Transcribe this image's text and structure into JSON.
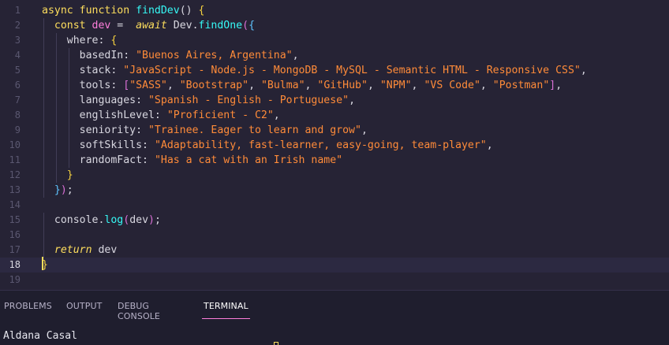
{
  "editor": {
    "current_line": 18,
    "lines": [
      {
        "n": "1",
        "tokens": [
          {
            "t": "async ",
            "c": "kw"
          },
          {
            "t": "function ",
            "c": "kw"
          },
          {
            "t": "findDev",
            "c": "fn"
          },
          {
            "t": "() ",
            "c": "obj"
          },
          {
            "t": "{",
            "c": "br1"
          }
        ]
      },
      {
        "n": "2",
        "tokens": [
          {
            "t": "  const ",
            "c": "kw"
          },
          {
            "t": "dev",
            "c": "var"
          },
          {
            "t": " =  ",
            "c": "obj"
          },
          {
            "t": "await ",
            "c": "kw2"
          },
          {
            "t": "Dev",
            "c": "obj"
          },
          {
            "t": ".",
            "c": "obj"
          },
          {
            "t": "findOne",
            "c": "fn"
          },
          {
            "t": "(",
            "c": "br2"
          },
          {
            "t": "{",
            "c": "br3"
          }
        ]
      },
      {
        "n": "3",
        "tokens": [
          {
            "t": "    where",
            "c": "prop"
          },
          {
            "t": ": ",
            "c": "obj"
          },
          {
            "t": "{",
            "c": "br1"
          }
        ]
      },
      {
        "n": "4",
        "tokens": [
          {
            "t": "      basedIn",
            "c": "prop"
          },
          {
            "t": ": ",
            "c": "obj"
          },
          {
            "t": "\"Buenos Aires, Argentina\"",
            "c": "str"
          },
          {
            "t": ",",
            "c": "obj"
          }
        ]
      },
      {
        "n": "5",
        "tokens": [
          {
            "t": "      stack",
            "c": "prop"
          },
          {
            "t": ": ",
            "c": "obj"
          },
          {
            "t": "\"JavaScript - Node.js - MongoDB - MySQL - Semantic HTML - Responsive CSS\"",
            "c": "str"
          },
          {
            "t": ",",
            "c": "obj"
          }
        ]
      },
      {
        "n": "6",
        "tokens": [
          {
            "t": "      tools",
            "c": "prop"
          },
          {
            "t": ": ",
            "c": "obj"
          },
          {
            "t": "[",
            "c": "br2"
          },
          {
            "t": "\"SASS\"",
            "c": "str"
          },
          {
            "t": ", ",
            "c": "obj"
          },
          {
            "t": "\"Bootstrap\"",
            "c": "str"
          },
          {
            "t": ", ",
            "c": "obj"
          },
          {
            "t": "\"Bulma\"",
            "c": "str"
          },
          {
            "t": ", ",
            "c": "obj"
          },
          {
            "t": "\"GitHub\"",
            "c": "str"
          },
          {
            "t": ", ",
            "c": "obj"
          },
          {
            "t": "\"NPM\"",
            "c": "str"
          },
          {
            "t": ", ",
            "c": "obj"
          },
          {
            "t": "\"VS Code\"",
            "c": "str"
          },
          {
            "t": ", ",
            "c": "obj"
          },
          {
            "t": "\"Postman\"",
            "c": "str"
          },
          {
            "t": "]",
            "c": "br2"
          },
          {
            "t": ",",
            "c": "obj"
          }
        ]
      },
      {
        "n": "7",
        "tokens": [
          {
            "t": "      languages",
            "c": "prop"
          },
          {
            "t": ": ",
            "c": "obj"
          },
          {
            "t": "\"Spanish - English - Portuguese\"",
            "c": "str"
          },
          {
            "t": ",",
            "c": "obj"
          }
        ]
      },
      {
        "n": "8",
        "tokens": [
          {
            "t": "      englishLevel",
            "c": "prop"
          },
          {
            "t": ": ",
            "c": "obj"
          },
          {
            "t": "\"Proficient - C2\"",
            "c": "str"
          },
          {
            "t": ",",
            "c": "obj"
          }
        ]
      },
      {
        "n": "9",
        "tokens": [
          {
            "t": "      seniority",
            "c": "prop"
          },
          {
            "t": ": ",
            "c": "obj"
          },
          {
            "t": "\"Trainee. Eager to learn and grow\"",
            "c": "str"
          },
          {
            "t": ",",
            "c": "obj"
          }
        ]
      },
      {
        "n": "10",
        "tokens": [
          {
            "t": "      softSkills",
            "c": "prop"
          },
          {
            "t": ": ",
            "c": "obj"
          },
          {
            "t": "\"Adaptability, fast-learner, easy-going, team-player\"",
            "c": "str"
          },
          {
            "t": ",",
            "c": "obj"
          }
        ]
      },
      {
        "n": "11",
        "tokens": [
          {
            "t": "      randomFact",
            "c": "prop"
          },
          {
            "t": ": ",
            "c": "obj"
          },
          {
            "t": "\"Has a cat with an Irish name\"",
            "c": "str"
          }
        ]
      },
      {
        "n": "12",
        "tokens": [
          {
            "t": "    }",
            "c": "br1"
          }
        ]
      },
      {
        "n": "13",
        "tokens": [
          {
            "t": "  }",
            "c": "br3"
          },
          {
            "t": ")",
            "c": "br2"
          },
          {
            "t": ";",
            "c": "obj"
          }
        ]
      },
      {
        "n": "14",
        "tokens": []
      },
      {
        "n": "15",
        "tokens": [
          {
            "t": "  console",
            "c": "obj"
          },
          {
            "t": ".",
            "c": "obj"
          },
          {
            "t": "log",
            "c": "fn"
          },
          {
            "t": "(",
            "c": "br2"
          },
          {
            "t": "dev",
            "c": "obj"
          },
          {
            "t": ")",
            "c": "br2"
          },
          {
            "t": ";",
            "c": "obj"
          }
        ]
      },
      {
        "n": "16",
        "tokens": []
      },
      {
        "n": "17",
        "tokens": [
          {
            "t": "  return ",
            "c": "kw2"
          },
          {
            "t": "dev",
            "c": "obj"
          }
        ]
      },
      {
        "n": "18",
        "tokens": [
          {
            "t": "}",
            "c": "br1"
          }
        ]
      },
      {
        "n": "19",
        "tokens": []
      }
    ]
  },
  "panel": {
    "tabs": [
      {
        "label": "PROBLEMS",
        "active": false
      },
      {
        "label": "OUTPUT",
        "active": false
      },
      {
        "label": "DEBUG CONSOLE",
        "active": false
      },
      {
        "label": "TERMINAL",
        "active": true
      }
    ],
    "terminal_output": "Aldana Casal"
  },
  "colors": {
    "editor_bg": "#262335",
    "panel_bg": "#1f1e2e",
    "keyword": "#fede5d",
    "function": "#36f9f6",
    "variable": "#ff7edb",
    "string": "#ff8b39",
    "active_tab_underline": "#ff7edb"
  }
}
